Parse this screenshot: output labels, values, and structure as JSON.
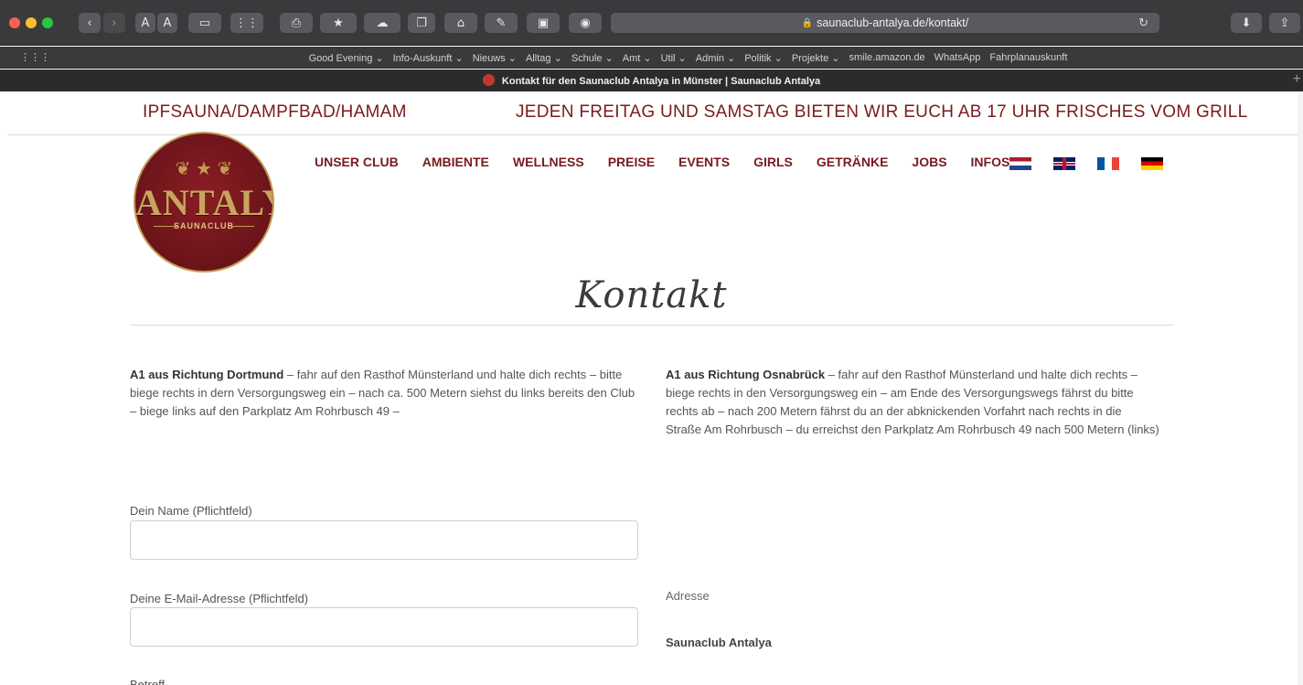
{
  "browser": {
    "url": "saunaclub-antalya.de/kontakt/",
    "tab_title": "Kontakt für den Saunaclub Antalya in Münster | Saunaclub Antalya",
    "text_size_a1": "A",
    "text_size_a2": "A",
    "favorites": [
      "Good Evening ⌄",
      "Info-Auskunft ⌄",
      "Nieuws ⌄",
      "Alltag ⌄",
      "Schule ⌄",
      "Amt ⌄",
      "Util ⌄",
      "Admin ⌄",
      "Politik ⌄",
      "Projekte ⌄",
      "smile.amazon.de",
      "WhatsApp",
      "Fahrplanauskunft"
    ]
  },
  "page": {
    "top_left": "IPFSAUNA/DAMPFBAD/HAMAM",
    "top_right": "JEDEN FREITAG UND SAMSTAG BIETEN WIR EUCH AB 17 UHR FRISCHES VOM GRILL",
    "logo": {
      "brand": "ANTALYA",
      "sub": "SAUNACLUB"
    },
    "nav": [
      "UNSER CLUB",
      "AMBIENTE",
      "WELLNESS",
      "PREISE",
      "EVENTS",
      "GIRLS",
      "GETRÄNKE",
      "JOBS",
      "INFOS"
    ],
    "heading": "Kontakt",
    "dir_left_title": "A1 aus Richtung Dortmund",
    "dir_left_text": " – fahr auf den Rasthof Münsterland und halte dich rechts – bitte biege rechts in dern Versorgungsweg ein – nach ca. 500 Metern siehst du links bereits den Club – biege links auf den Parkplatz Am Rohrbusch 49 –",
    "dir_right_title": "A1 aus Richtung Osnabrück",
    "dir_right_text": " – fahr auf den Rasthof Münsterland und halte dich rechts – biege rechts in den Versorgungsweg ein – am Ende des Versorgungswegs fährst du bitte rechts ab – nach 200 Metern fährst du an der abknickenden Vorfahrt nach rechts in die Straße Am Rohrbusch – du erreichst den Parkplatz Am Rohrbusch 49 nach 500 Metern (links)",
    "form": {
      "name_label": "Dein Name (Pflichtfeld)",
      "email_label": "Deine E-Mail-Adresse (Pflichtfeld)",
      "subject_label": "Betreff"
    },
    "address_label": "Adresse",
    "address_name": "Saunaclub Antalya"
  }
}
